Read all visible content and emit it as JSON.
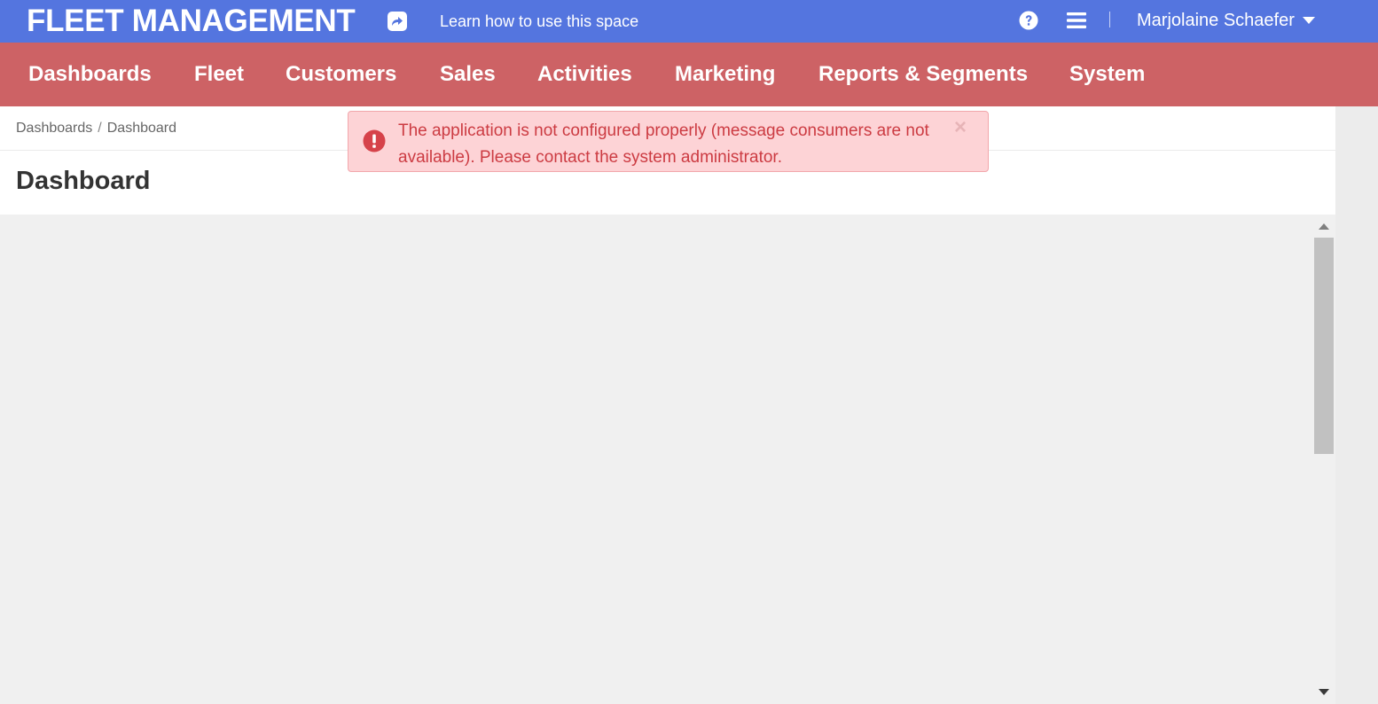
{
  "topbar": {
    "app_title": "FLEET MANAGEMENT",
    "learn_link": "Learn how to use this space",
    "user_name": "Marjolaine Schaefer",
    "icons": [
      "share-icon",
      "help-icon",
      "menu-icon",
      "caret-down-icon"
    ]
  },
  "nav": {
    "items": [
      {
        "label": "Dashboards"
      },
      {
        "label": "Fleet"
      },
      {
        "label": "Customers"
      },
      {
        "label": "Sales"
      },
      {
        "label": "Activities"
      },
      {
        "label": "Marketing"
      },
      {
        "label": "Reports & Segments"
      },
      {
        "label": "System"
      }
    ]
  },
  "breadcrumb": {
    "items": [
      "Dashboards",
      "Dashboard"
    ],
    "separator": "/"
  },
  "page": {
    "title": "Dashboard"
  },
  "alert": {
    "message": "The application is not configured properly (message consumers are not available). Please contact the system administrator.",
    "close_label": "×",
    "icon": "error-icon"
  },
  "colors": {
    "topbar_bg": "#5475df",
    "nav_bg": "#cd6265",
    "alert_bg": "#fdd3d6",
    "alert_text": "#cc3b42"
  }
}
